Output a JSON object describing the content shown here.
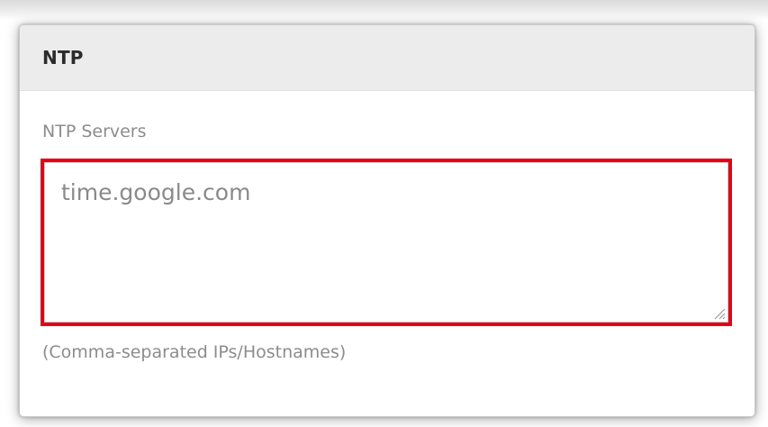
{
  "ntp_panel": {
    "title": "NTP",
    "servers_label": "NTP Servers",
    "servers_value": "time.google.com",
    "servers_hint": "(Comma-separated IPs/Hostnames)",
    "highlight_color": "#e60012"
  },
  "icons": {
    "resize_grip": "resize-grip-icon"
  }
}
